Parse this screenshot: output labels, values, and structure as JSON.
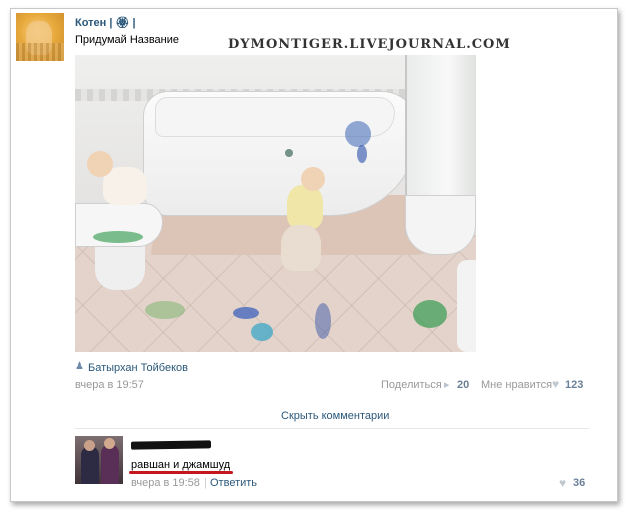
{
  "post": {
    "group_name": "Котен",
    "group_name_extra": "| 🏵 |",
    "title": "Придумай Название",
    "watermark": "DYMONTIGER.LIVEJOURNAL.COM",
    "author": "Батырхан Тойбеков",
    "time": "вчера в 19:57",
    "share_label": "Поделиться",
    "share_count": "20",
    "like_label": "Мне нравится",
    "like_count": "123",
    "hide_comments": "Скрыть комментарии"
  },
  "comment": {
    "text": "равшан и джамшуд",
    "time": "вчера в 19:58",
    "separator": "|",
    "reply_label": "Ответить",
    "like_count": "36"
  },
  "icons": {
    "author": "person-icon",
    "share": "megaphone-icon",
    "like": "heart-icon"
  },
  "colors": {
    "link": "#2b587a",
    "muted": "#999999",
    "count": "#6b8097",
    "underline": "#c5161d"
  }
}
